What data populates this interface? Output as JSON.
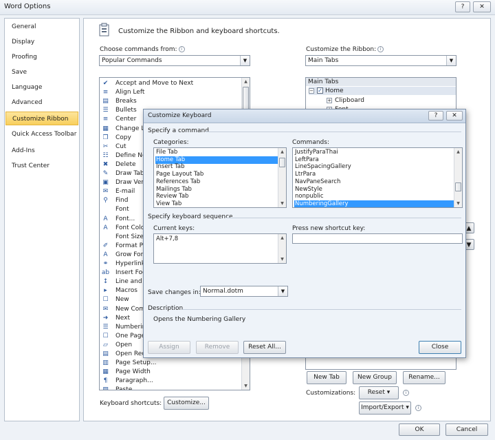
{
  "window": {
    "title": "Word Options",
    "help_label": "?",
    "close_label": "✕"
  },
  "nav": {
    "items": [
      {
        "label": "General"
      },
      {
        "label": "Display"
      },
      {
        "label": "Proofing"
      },
      {
        "label": "Save"
      },
      {
        "label": "Language"
      },
      {
        "label": "Advanced"
      },
      {
        "label": "Customize Ribbon",
        "active": true
      },
      {
        "label": "Quick Access Toolbar"
      },
      {
        "label": "Add-Ins"
      },
      {
        "label": "Trust Center"
      }
    ]
  },
  "main": {
    "header": "Customize the Ribbon and keyboard shortcuts.",
    "choose_label": "Choose commands from:",
    "choose_value": "Popular Commands",
    "ribbon_label": "Customize the Ribbon:",
    "ribbon_value": "Main Tabs",
    "commands": [
      {
        "label": "Accept and Move to Next",
        "icon": "✔"
      },
      {
        "label": "Align Left",
        "icon": "≡"
      },
      {
        "label": "Breaks",
        "icon": "▤"
      },
      {
        "label": "Bullets",
        "icon": "☰"
      },
      {
        "label": "Center",
        "icon": "≡"
      },
      {
        "label": "Change Li",
        "icon": "▦"
      },
      {
        "label": "Copy",
        "icon": "❐"
      },
      {
        "label": "Cut",
        "icon": "✂"
      },
      {
        "label": "Define Ne",
        "icon": "☷"
      },
      {
        "label": "Delete",
        "icon": "✖"
      },
      {
        "label": "Draw Tabl",
        "icon": "✎"
      },
      {
        "label": "Draw Vert",
        "icon": "▣"
      },
      {
        "label": "E-mail",
        "icon": "✉"
      },
      {
        "label": "Find",
        "icon": "⚲"
      },
      {
        "label": "Font",
        "icon": ""
      },
      {
        "label": "Font...",
        "icon": "A"
      },
      {
        "label": "Font Colo",
        "icon": "A"
      },
      {
        "label": "Font Size",
        "icon": ""
      },
      {
        "label": "Format Pa",
        "icon": "✐"
      },
      {
        "label": "Grow Fon",
        "icon": "A"
      },
      {
        "label": "Hyperlink",
        "icon": "⚭"
      },
      {
        "label": "Insert Foo",
        "icon": "ab"
      },
      {
        "label": "Line and P",
        "icon": "↕"
      },
      {
        "label": "Macros",
        "icon": "▸"
      },
      {
        "label": "New",
        "icon": "☐"
      },
      {
        "label": "New Com",
        "icon": "✉"
      },
      {
        "label": "Next",
        "icon": "➜"
      },
      {
        "label": "Numbering",
        "icon": "☰"
      },
      {
        "label": "One Page",
        "icon": "☐"
      },
      {
        "label": "Open",
        "icon": "▱"
      },
      {
        "label": "Open Rec",
        "icon": "▤"
      },
      {
        "label": "Page Setup...",
        "icon": "▥"
      },
      {
        "label": "Page Width",
        "icon": "▦"
      },
      {
        "label": "Paragraph...",
        "icon": "¶"
      },
      {
        "label": "Paste",
        "icon": "▨"
      }
    ],
    "tabs_tree": {
      "header": "Main Tabs",
      "home_label": "Home",
      "clipboard_label": "Clipboard",
      "font_label": "Font"
    },
    "keyboard_shortcuts_label": "Keyboard shortcuts:",
    "customize_button": "Customize...",
    "new_tab_button": "New Tab",
    "new_group_button": "New Group",
    "rename_button": "Rename...",
    "customizations_label": "Customizations:",
    "reset_button": "Reset ▾",
    "import_export_button": "Import/Export ▾"
  },
  "footer": {
    "ok_button": "OK",
    "cancel_button": "Cancel"
  },
  "keyboard_dialog": {
    "title": "Customize Keyboard",
    "help_label": "?",
    "close_label": "✕",
    "specify_command": "Specify a command",
    "categories_label": "Categories:",
    "categories": [
      {
        "label": "File Tab"
      },
      {
        "label": "Home Tab",
        "selected": true
      },
      {
        "label": "Insert Tab"
      },
      {
        "label": "Page Layout Tab"
      },
      {
        "label": "References Tab"
      },
      {
        "label": "Mailings Tab"
      },
      {
        "label": "Review Tab"
      },
      {
        "label": "View Tab"
      }
    ],
    "commands_label": "Commands:",
    "commands": [
      {
        "label": "JustifyParaThai"
      },
      {
        "label": "LeftPara"
      },
      {
        "label": "LineSpacingGallery"
      },
      {
        "label": "LtrPara"
      },
      {
        "label": "NavPaneSearch"
      },
      {
        "label": "NewStyle"
      },
      {
        "label": "nonpublic"
      },
      {
        "label": "NumberingGallery",
        "selected": true
      }
    ],
    "specify_sequence": "Specify keyboard sequence",
    "current_keys_label": "Current keys:",
    "current_keys_value": "Alt+7,8",
    "new_shortcut_label": "Press new shortcut key:",
    "new_shortcut_value": "",
    "save_changes_label": "Save changes in:",
    "save_changes_value": "Normal.dotm",
    "description_label": "Description",
    "description_text": "Opens the Numbering Gallery",
    "assign_button": "Assign",
    "remove_button": "Remove",
    "reset_all_button": "Reset All...",
    "close_button": "Close"
  }
}
